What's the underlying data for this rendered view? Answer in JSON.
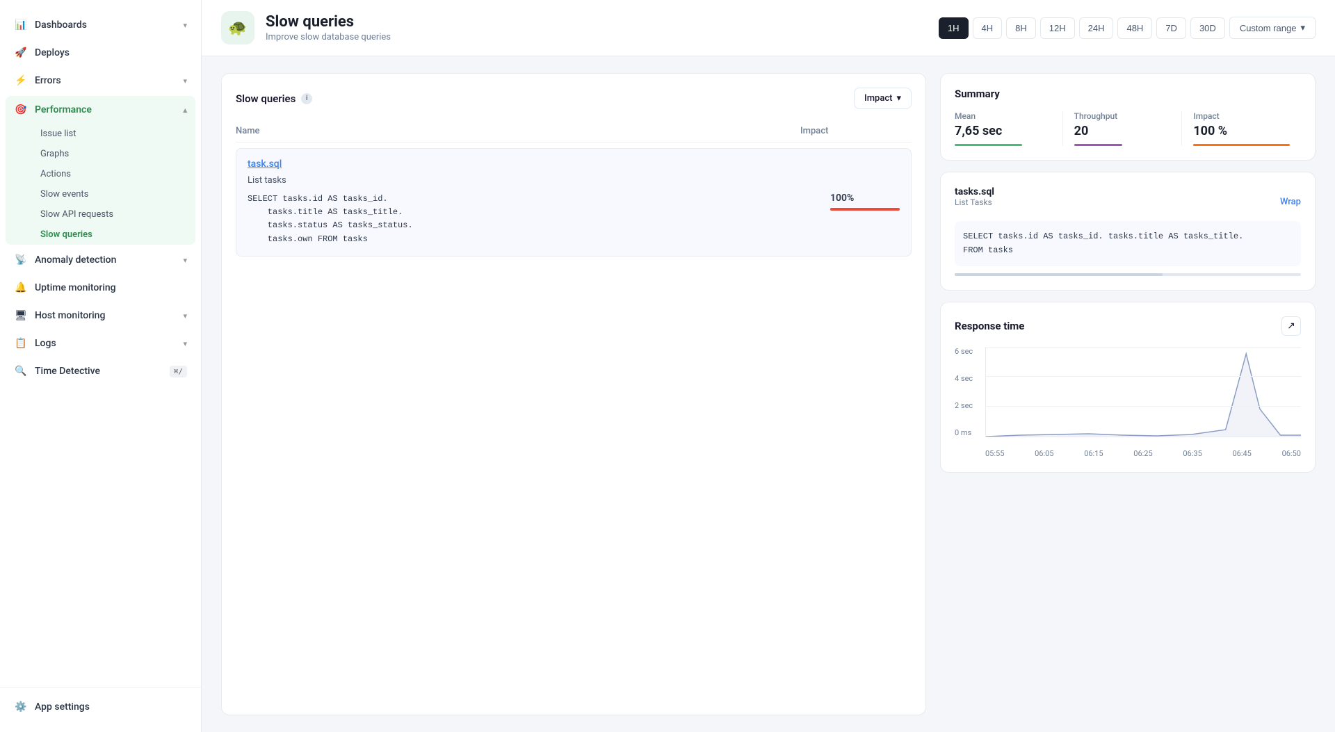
{
  "sidebar": {
    "items": [
      {
        "id": "dashboards",
        "label": "Dashboards",
        "icon": "📊",
        "hasChevron": true,
        "active": false
      },
      {
        "id": "deploys",
        "label": "Deploys",
        "icon": "🚀",
        "hasChevron": false,
        "active": false
      },
      {
        "id": "errors",
        "label": "Errors",
        "icon": "⚡",
        "hasChevron": true,
        "active": false
      },
      {
        "id": "performance",
        "label": "Performance",
        "icon": "🎯",
        "hasChevron": true,
        "active": true
      },
      {
        "id": "anomaly",
        "label": "Anomaly detection",
        "icon": "📡",
        "hasChevron": true,
        "active": false
      },
      {
        "id": "uptime",
        "label": "Uptime monitoring",
        "icon": "🔔",
        "hasChevron": false,
        "active": false
      },
      {
        "id": "host",
        "label": "Host monitoring",
        "icon": "🖥",
        "hasChevron": true,
        "active": false
      },
      {
        "id": "logs",
        "label": "Logs",
        "icon": "📋",
        "hasChevron": true,
        "active": false
      },
      {
        "id": "timedetective",
        "label": "Time Detective",
        "icon": "🔍",
        "hasChevron": false,
        "active": false,
        "badge": "⌘/"
      }
    ],
    "performance_subitems": [
      {
        "id": "issue-list",
        "label": "Issue list",
        "active": false
      },
      {
        "id": "graphs",
        "label": "Graphs",
        "active": false
      },
      {
        "id": "actions",
        "label": "Actions",
        "active": false
      },
      {
        "id": "slow-events",
        "label": "Slow events",
        "active": false
      },
      {
        "id": "slow-api-requests",
        "label": "Slow API requests",
        "active": false
      },
      {
        "id": "slow-queries",
        "label": "Slow queries",
        "active": true
      }
    ],
    "app_settings": {
      "label": "App settings",
      "icon": "⚙️"
    }
  },
  "header": {
    "icon": "🐢",
    "title": "Slow queries",
    "subtitle": "Improve slow database queries",
    "time_filters": [
      "1H",
      "4H",
      "8H",
      "12H",
      "24H",
      "48H",
      "7D",
      "30D"
    ],
    "active_filter": "1H",
    "custom_range": "Custom range"
  },
  "queries_panel": {
    "title": "Slow queries",
    "sort_label": "Impact",
    "columns": {
      "name": "Name",
      "impact": "Impact"
    },
    "rows": [
      {
        "file": "task.sql",
        "description": "List tasks",
        "sql": "SELECT tasks.id AS tasks_id.\n    tasks.title AS tasks_title.\n    tasks.status AS tasks_status.\n    tasks.own FROM tasks",
        "impact_pct": "100%"
      }
    ]
  },
  "summary": {
    "title": "Summary",
    "mean_label": "Mean",
    "mean_value": "7,65 sec",
    "throughput_label": "Throughput",
    "throughput_value": "20",
    "impact_label": "Impact",
    "impact_value": "100 %"
  },
  "detail": {
    "title": "tasks.sql",
    "subtitle": "List Tasks",
    "wrap_label": "Wrap",
    "sql": "SELECT tasks.id AS tasks_id. tasks.title AS tasks_title.\nFROM tasks"
  },
  "chart": {
    "title": "Response time",
    "y_labels": [
      "6 sec",
      "4 sec",
      "2 sec",
      "0 ms"
    ],
    "x_labels": [
      "05:55",
      "06:05",
      "06:15",
      "06:25",
      "06:35",
      "06:45",
      "06:50"
    ],
    "export_icon": "↗"
  }
}
